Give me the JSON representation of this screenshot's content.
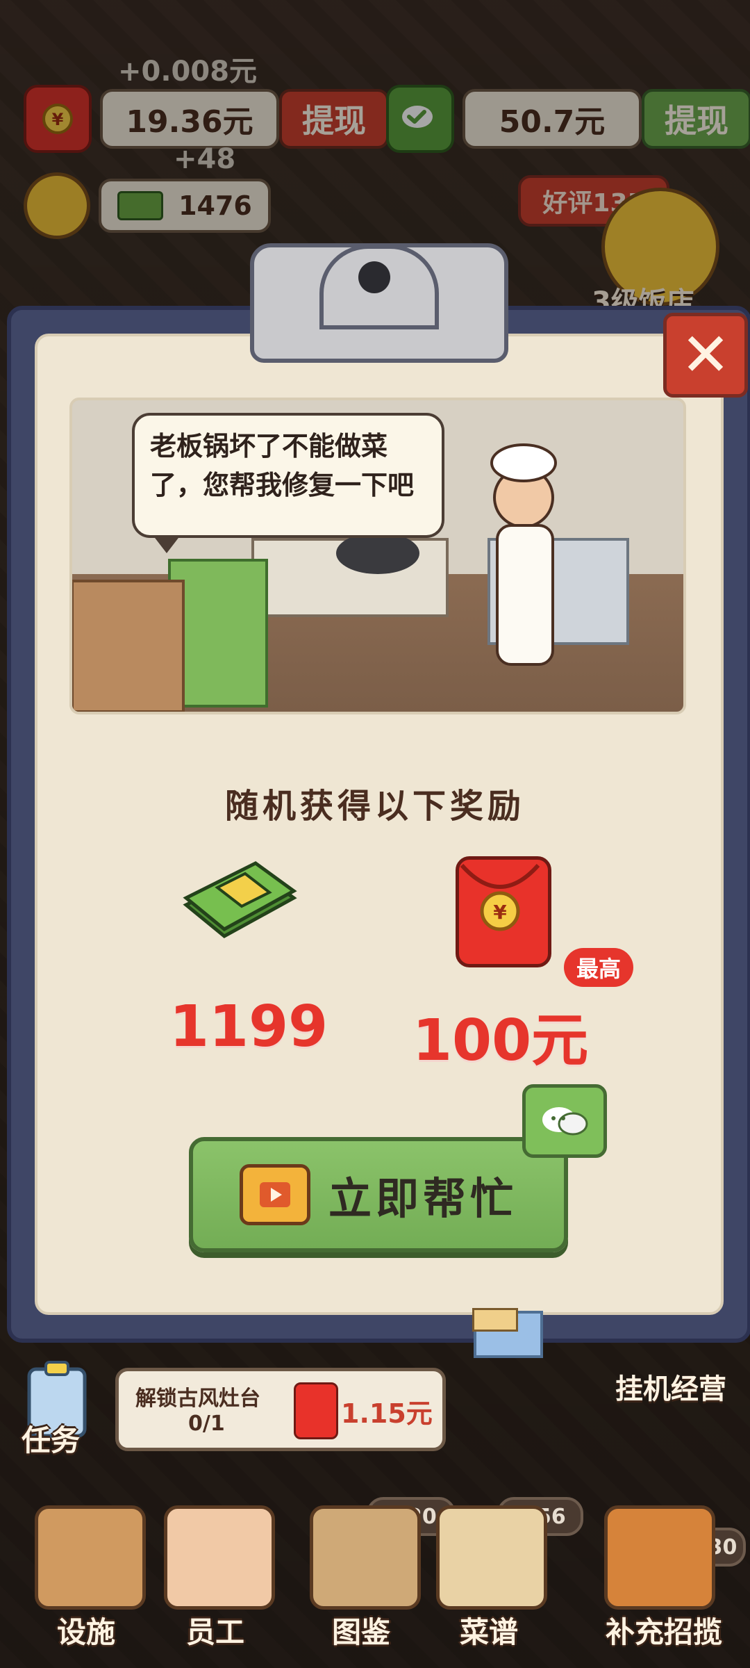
{
  "hud": {
    "gain_money": "+0.008元",
    "cash_balance": "19.36元",
    "withdraw_label": "提现",
    "wechat_balance": "50.7元",
    "wechat_withdraw_label": "提现",
    "gain_coins": "+48",
    "coins": "1476",
    "praise": "好评135",
    "level": "3级饭店"
  },
  "dialog": {
    "message": "老板锅坏了不能做菜了，您帮我修复一下吧",
    "reward_title": "随机获得以下奖励",
    "reward_coins": "1199",
    "reward_cash": "100元",
    "badge_max": "最高",
    "help_button_label": "立即帮忙",
    "close_label": "✕"
  },
  "task": {
    "label": "任务",
    "description": "解锁古风灶台",
    "progress": "0/1",
    "reward": "1.15元",
    "idle_label": "挂机经营"
  },
  "nav": {
    "items": [
      {
        "label": "设施"
      },
      {
        "label": "员工"
      },
      {
        "label": "图鉴",
        "counter": "8/20"
      },
      {
        "label": "菜谱",
        "counter": "7/56"
      },
      {
        "label": "补充招揽",
        "counter": "+30"
      }
    ]
  },
  "colors": {
    "primary_red": "#e6352c",
    "button_green": "#73ad55",
    "panel_cream": "#efe6d3",
    "modal_frame": "#3f4666"
  }
}
